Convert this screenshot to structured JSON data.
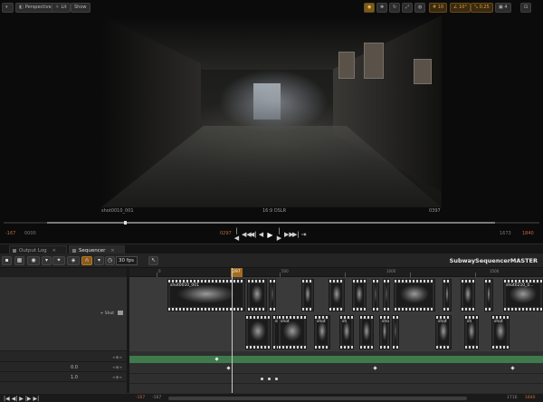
{
  "viewport": {
    "toolbar": {
      "perspective_label": "Perspective",
      "lit_label": "Lit",
      "show_label": "Show",
      "right_values": [
        "10",
        "10°",
        "0.25",
        "4"
      ]
    },
    "labels": {
      "shot_name": "shot0010_001",
      "aspect": "16:9 DSLR",
      "frame": "0397"
    },
    "scrub_progress": 0.22,
    "transport": {
      "range_start_red": "-167",
      "range_start_gray": "0000",
      "current_red": "0297",
      "range_end_gray": "1673",
      "range_end_red": "1840",
      "buttons": [
        "|◀",
        "◀◀",
        "◀|",
        "◀",
        "▶",
        "|▶",
        "▶▶",
        "▶|",
        "⇥"
      ]
    }
  },
  "tabs": [
    {
      "label": "Output Log",
      "active": false
    },
    {
      "label": "Sequencer",
      "active": true
    }
  ],
  "sequencer": {
    "fps_label": "30 fps",
    "sequence_title": "SubwaySequencerMASTER",
    "add_shot_label": "+ Shot",
    "ruler": {
      "current_frame": "297",
      "labels": [
        "0",
        "500",
        "1000",
        "1500"
      ]
    },
    "clips_top": [
      {
        "label": "shot0010_001"
      },
      {
        "label": ""
      },
      {
        "label": ""
      },
      {
        "label": ""
      },
      {
        "label": ""
      },
      {
        "label": ""
      },
      {
        "label": ""
      },
      {
        "label": ""
      },
      {
        "label": ""
      },
      {
        "label": ""
      },
      {
        "label": ""
      },
      {
        "label": ""
      },
      {
        "label": "shot0210_0..."
      }
    ],
    "clips_bottom": [
      {
        "label": ""
      },
      {
        "label": "shot002..."
      },
      {
        "label": "shot"
      },
      {
        "label": "shot"
      },
      {
        "label": "sh"
      },
      {
        "label": ""
      },
      {
        "label": "shot"
      },
      {
        "label": ""
      },
      {
        "label": "shot"
      },
      {
        "label": "sh"
      },
      {
        "label": "shot"
      }
    ],
    "rows": [
      {
        "value": "0.0"
      },
      {
        "value": "1.0"
      }
    ]
  },
  "bottom": {
    "left_red": "-167",
    "left_gray": "-167",
    "right_gray": "1716",
    "right_red": "1840"
  },
  "colors": {
    "accent_orange": "#a26d1f",
    "track_green": "#3f7a4c",
    "frame_red": "#c06a3a"
  }
}
